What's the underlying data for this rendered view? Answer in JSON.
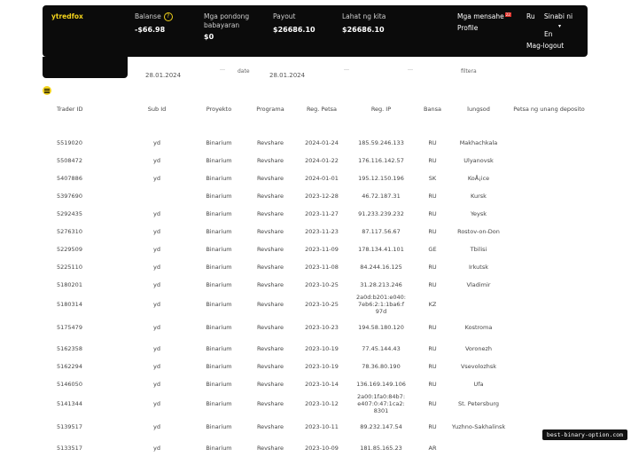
{
  "header": {
    "brand": "ytredfox",
    "balance_label": "Balanse",
    "balance_value": "-$66.98",
    "hold_label": "Mga pondong babayaran",
    "hold_value": "$0",
    "payout_label": "Payout",
    "payout_value": "$26686.10",
    "total_label": "Lahat ng kita",
    "total_value": "$26686.10",
    "messages_label": "Mga mensahe",
    "messages_count": "22",
    "profile_label": "Profile",
    "lang_current": "Ru",
    "lang_option1": "Sinabi ni",
    "lang_option2": "En",
    "logout_label": "Mag-logout"
  },
  "filters": {
    "date_from": "28.01.2024",
    "date_label": "date",
    "date_to": "28.01.2024",
    "filter_label": "filtera"
  },
  "table": {
    "columns": [
      "Trader ID",
      "Sub Id",
      "Proyekto",
      "Programa",
      "Reg. Petsa",
      "Reg. IP",
      "Bansa",
      "lungsod",
      "Petsa ng unang deposito"
    ],
    "rows": [
      {
        "id": "5519020",
        "sub": "yd",
        "project": "Binarium",
        "program": "Revshare",
        "date": "2024-01-24",
        "ip": "185.59.246.133",
        "country": "RU",
        "city": "Makhachkala"
      },
      {
        "id": "5508472",
        "sub": "yd",
        "project": "Binarium",
        "program": "Revshare",
        "date": "2024-01-22",
        "ip": "176.116.142.57",
        "country": "RU",
        "city": "Ulyanovsk"
      },
      {
        "id": "5407886",
        "sub": "yd",
        "project": "Binarium",
        "program": "Revshare",
        "date": "2024-01-01",
        "ip": "195.12.150.196",
        "country": "SK",
        "city": "KoÅ¡ice"
      },
      {
        "id": "5397690",
        "sub": "",
        "project": "Binarium",
        "program": "Revshare",
        "date": "2023-12-28",
        "ip": "46.72.187.31",
        "country": "RU",
        "city": "Kursk"
      },
      {
        "id": "5292435",
        "sub": "yd",
        "project": "Binarium",
        "program": "Revshare",
        "date": "2023-11-27",
        "ip": "91.233.239.232",
        "country": "RU",
        "city": "Yeysk"
      },
      {
        "id": "5276310",
        "sub": "yd",
        "project": "Binarium",
        "program": "Revshare",
        "date": "2023-11-23",
        "ip": "87.117.56.67",
        "country": "RU",
        "city": "Rostov-on-Don"
      },
      {
        "id": "5229509",
        "sub": "yd",
        "project": "Binarium",
        "program": "Revshare",
        "date": "2023-11-09",
        "ip": "178.134.41.101",
        "country": "GE",
        "city": "Tbilisi"
      },
      {
        "id": "5225110",
        "sub": "yd",
        "project": "Binarium",
        "program": "Revshare",
        "date": "2023-11-08",
        "ip": "84.244.16.125",
        "country": "RU",
        "city": "Irkutsk"
      },
      {
        "id": "5180201",
        "sub": "yd",
        "project": "Binarium",
        "program": "Revshare",
        "date": "2023-10-25",
        "ip": "31.28.213.246",
        "country": "RU",
        "city": "Vladimir"
      },
      {
        "id": "5180314",
        "sub": "yd",
        "project": "Binarium",
        "program": "Revshare",
        "date": "2023-10-25",
        "ip": "2a0d:b201:e040:7eb6:2:1:1ba6:f97d",
        "country": "KZ",
        "city": ""
      },
      {
        "id": "5175479",
        "sub": "yd",
        "project": "Binarium",
        "program": "Revshare",
        "date": "2023-10-23",
        "ip": "194.58.180.120",
        "country": "RU",
        "city": "Kostroma"
      },
      {
        "id": "5162358",
        "sub": "yd",
        "project": "Binarium",
        "program": "Revshare",
        "date": "2023-10-19",
        "ip": "77.45.144.43",
        "country": "RU",
        "city": "Voronezh"
      },
      {
        "id": "5162294",
        "sub": "yd",
        "project": "Binarium",
        "program": "Revshare",
        "date": "2023-10-19",
        "ip": "78.36.80.190",
        "country": "RU",
        "city": "Vsevolozhsk"
      },
      {
        "id": "5146050",
        "sub": "yd",
        "project": "Binarium",
        "program": "Revshare",
        "date": "2023-10-14",
        "ip": "136.169.149.106",
        "country": "RU",
        "city": "Ufa"
      },
      {
        "id": "5141344",
        "sub": "yd",
        "project": "Binarium",
        "program": "Revshare",
        "date": "2023-10-12",
        "ip": "2a00:1fa0:84b7:e407:0:47:1ca2:8301",
        "country": "RU",
        "city": "St. Petersburg"
      },
      {
        "id": "5139517",
        "sub": "yd",
        "project": "Binarium",
        "program": "Revshare",
        "date": "2023-10-11",
        "ip": "89.232.147.54",
        "country": "RU",
        "city": "Yuzhno-Sakhalinsk"
      },
      {
        "id": "5133517",
        "sub": "yd",
        "project": "Binarium",
        "program": "Revshare",
        "date": "2023-10-09",
        "ip": "181.85.165.23",
        "country": "AR",
        "city": ""
      }
    ]
  },
  "watermark": "best-binary-option.com"
}
